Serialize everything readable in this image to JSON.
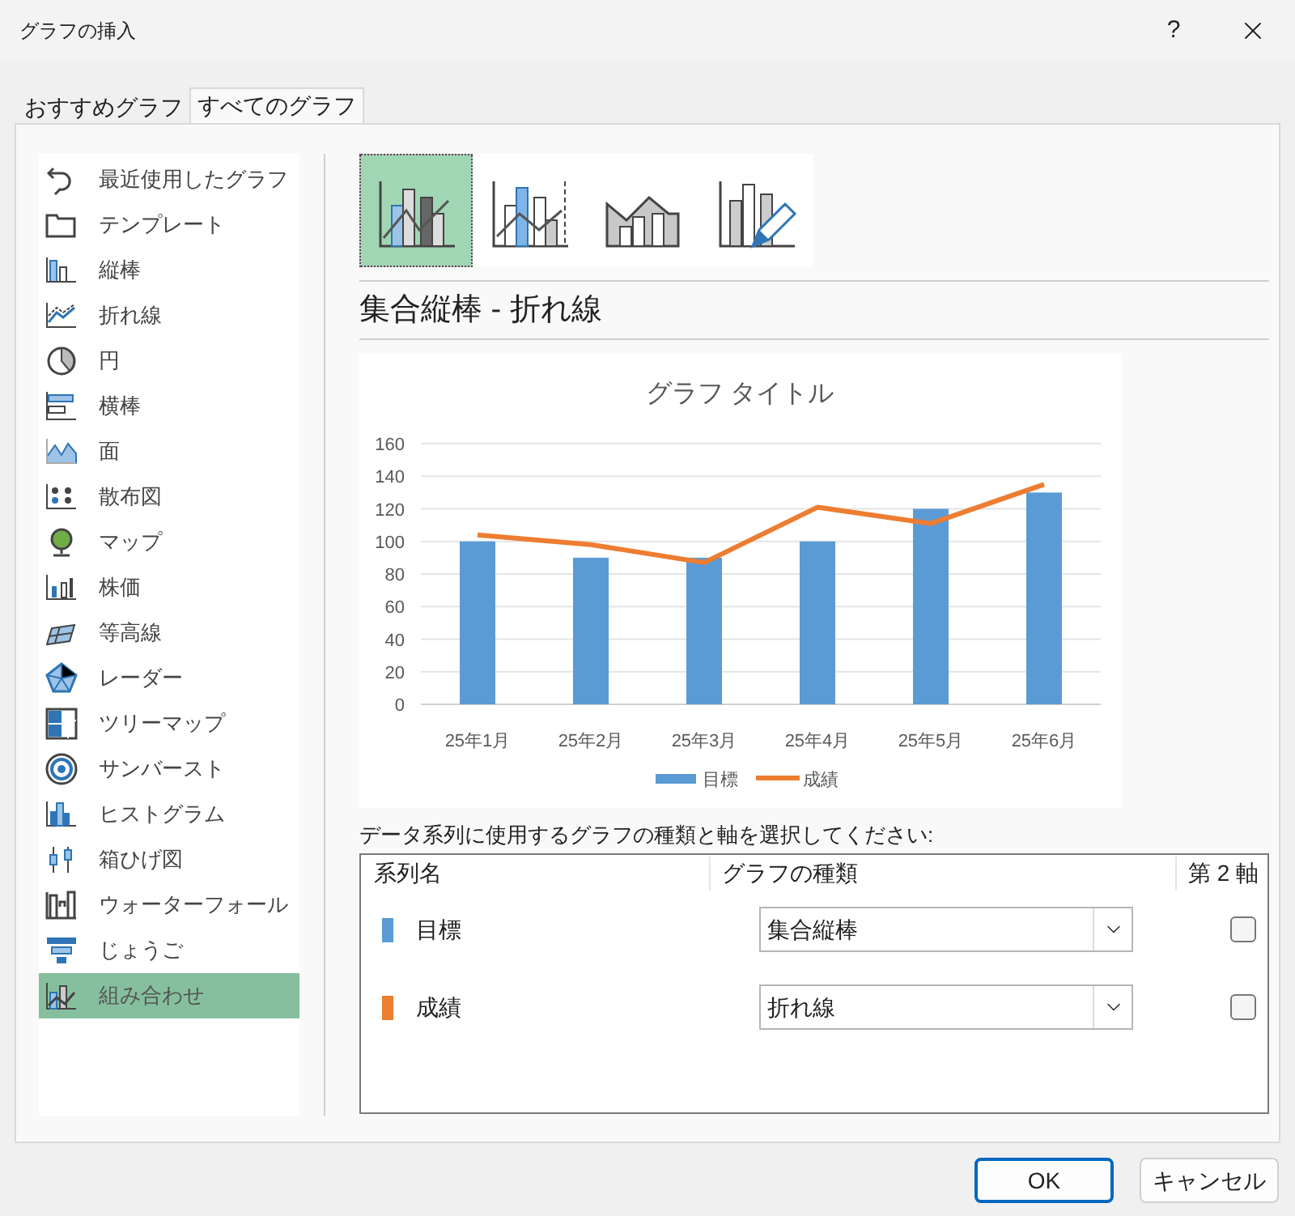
{
  "window": {
    "title": "グラフの挿入",
    "help": "?"
  },
  "tabs": [
    {
      "label": "おすすめグラフ",
      "selected": false
    },
    {
      "label": "すべてのグラフ",
      "selected": true
    }
  ],
  "sidebar": {
    "items": [
      {
        "label": "最近使用したグラフ",
        "selected": false
      },
      {
        "label": "テンプレート",
        "selected": false
      },
      {
        "label": "縦棒",
        "selected": false
      },
      {
        "label": "折れ線",
        "selected": false
      },
      {
        "label": "円",
        "selected": false
      },
      {
        "label": "横棒",
        "selected": false
      },
      {
        "label": "面",
        "selected": false
      },
      {
        "label": "散布図",
        "selected": false
      },
      {
        "label": "マップ",
        "selected": false
      },
      {
        "label": "株価",
        "selected": false
      },
      {
        "label": "等高線",
        "selected": false
      },
      {
        "label": "レーダー",
        "selected": false
      },
      {
        "label": "ツリーマップ",
        "selected": false
      },
      {
        "label": "サンバースト",
        "selected": false
      },
      {
        "label": "ヒストグラム",
        "selected": false
      },
      {
        "label": "箱ひげ図",
        "selected": false
      },
      {
        "label": "ウォーターフォール",
        "selected": false
      },
      {
        "label": "じょうご",
        "selected": false
      },
      {
        "label": "組み合わせ",
        "selected": true
      }
    ]
  },
  "subtypes": [
    {
      "selected": true
    },
    {
      "selected": false
    },
    {
      "selected": false
    },
    {
      "selected": false
    }
  ],
  "subtype_title": "集合縦棒 - 折れ線",
  "preview": {
    "chart_data": {
      "type": "bar",
      "title": "グラフ タイトル",
      "categories": [
        "25年1月",
        "25年2月",
        "25年3月",
        "25年4月",
        "25年5月",
        "25年6月"
      ],
      "series": [
        {
          "name": "目標",
          "color": "#5b9bd5",
          "type": "bar",
          "values": [
            100,
            90,
            90,
            100,
            120,
            130
          ]
        },
        {
          "name": "成績",
          "color": "#ed7d31",
          "type": "line",
          "values": [
            104,
            98,
            87,
            121,
            111,
            135
          ]
        }
      ],
      "stacked": false,
      "grid": true,
      "legend": "bottom",
      "ylim": [
        0,
        160
      ],
      "yticks": [
        0,
        20,
        40,
        60,
        80,
        100,
        120,
        140,
        160
      ]
    }
  },
  "series_prompt": "データ系列に使用するグラフの種類と軸を選択してください:",
  "series_table": {
    "columns": [
      "系列名",
      "グラフの種類",
      "第 2 軸"
    ],
    "rows": [
      {
        "name": "目標",
        "color": "#5b9bd5",
        "chart_type": "集合縦棒",
        "secondary_axis": false
      },
      {
        "name": "成績",
        "color": "#ed7d31",
        "chart_type": "折れ線",
        "secondary_axis": false
      }
    ]
  },
  "buttons": [
    {
      "label": "OK",
      "default": true
    },
    {
      "label": "キャンセル",
      "default": false
    }
  ]
}
